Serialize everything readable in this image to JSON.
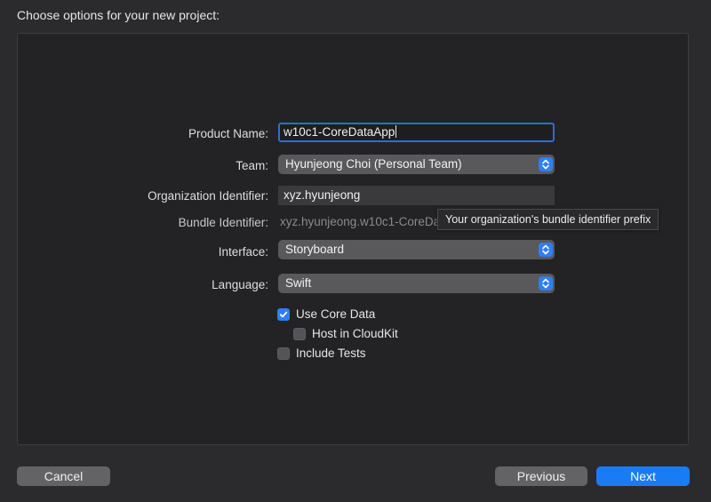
{
  "header": {
    "title": "Choose options for your new project:"
  },
  "form": {
    "product_name": {
      "label": "Product Name:",
      "value": "w10c1-CoreDataApp"
    },
    "team": {
      "label": "Team:",
      "value": "Hyunjeong Choi (Personal Team)"
    },
    "org_id": {
      "label": "Organization Identifier:",
      "value": "xyz.hyunjeong"
    },
    "bundle_id": {
      "label": "Bundle Identifier:",
      "value": "xyz.hyunjeong.w10c1-CoreDa"
    },
    "interface": {
      "label": "Interface:",
      "value": "Storyboard"
    },
    "language": {
      "label": "Language:",
      "value": "Swift"
    }
  },
  "tooltip": {
    "text": "Your organization's bundle identifier prefix"
  },
  "options": {
    "use_core_data": {
      "label": "Use Core Data",
      "checked": true
    },
    "host_in_cloudkit": {
      "label": "Host in CloudKit",
      "checked": false
    },
    "include_tests": {
      "label": "Include Tests",
      "checked": false
    }
  },
  "buttons": {
    "cancel": "Cancel",
    "previous": "Previous",
    "next": "Next"
  },
  "colors": {
    "accent": "#2f7ef6",
    "primary_button": "#1a7cf5",
    "focus_ring": "#2a6fd1"
  },
  "icons": {
    "stepper": "chevron-up-down-icon",
    "checkmark": "checkmark-icon"
  }
}
